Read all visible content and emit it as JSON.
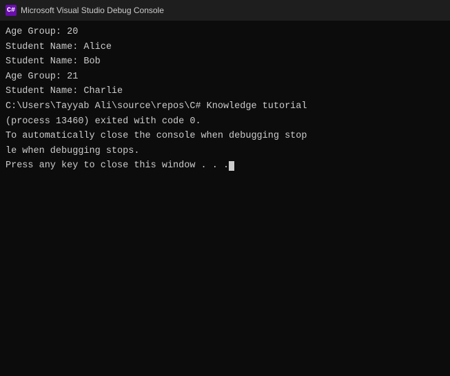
{
  "titleBar": {
    "iconText": "C#",
    "title": "Microsoft Visual Studio Debug Console"
  },
  "console": {
    "lines": [
      {
        "text": "Age Group: 20",
        "dim": false
      },
      {
        "text": "Student Name: Alice",
        "dim": false
      },
      {
        "text": "Student Name: Bob",
        "dim": false
      },
      {
        "text": "Age Group: 21",
        "dim": false
      },
      {
        "text": "Student Name: Charlie",
        "dim": false
      },
      {
        "text": "",
        "dim": false
      },
      {
        "text": "C:\\Users\\Tayyab Ali\\source\\repos\\C# Knowledge tutorial",
        "dim": false
      },
      {
        "text": "(process 13460) exited with code 0.",
        "dim": false
      },
      {
        "text": "To automatically close the console when debugging stop",
        "dim": false
      },
      {
        "text": "le when debugging stops.",
        "dim": false
      },
      {
        "text": "Press any key to close this window . . .",
        "dim": false,
        "cursor": true
      }
    ]
  }
}
